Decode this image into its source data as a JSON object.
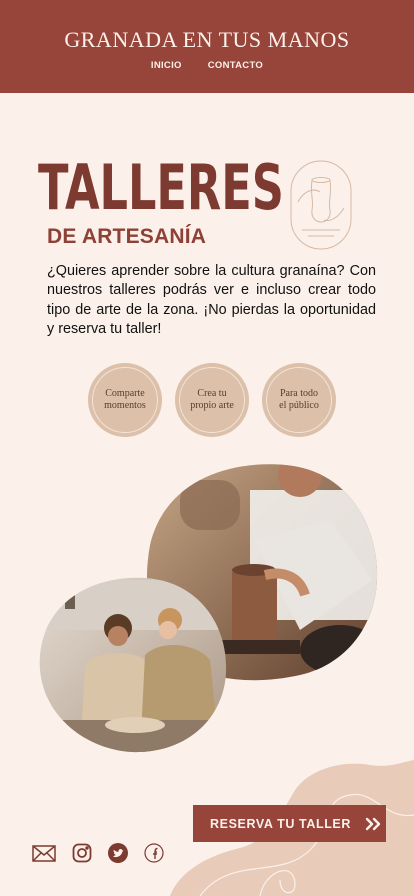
{
  "header": {
    "brand": "GRANADA EN TUS MANOS",
    "nav": [
      "INICIO",
      "CONTACTO"
    ]
  },
  "hero": {
    "title": "TALLERES",
    "subtitle": "DE ARTESANÍA",
    "intro": "¿Quieres aprender sobre la cultura granaína? Con nuestros talleres podrás ver  e incluso crear todo tipo de arte de la zona. ¡No pierdas la oportunidad y reserva tu taller!"
  },
  "badges": [
    {
      "label": "Comparte\nmomentos"
    },
    {
      "label": "Crea tu\npropio arte"
    },
    {
      "label": "Para todo\nel público"
    }
  ],
  "cta": {
    "label": "RESERVA TU TALLER"
  },
  "socials": [
    "mail-icon",
    "instagram-icon",
    "twitter-icon",
    "facebook-icon"
  ],
  "colors": {
    "brand": "#97453a",
    "background": "#fbf1ea",
    "badge": "#dcc0aa",
    "title": "#7d3a30"
  }
}
